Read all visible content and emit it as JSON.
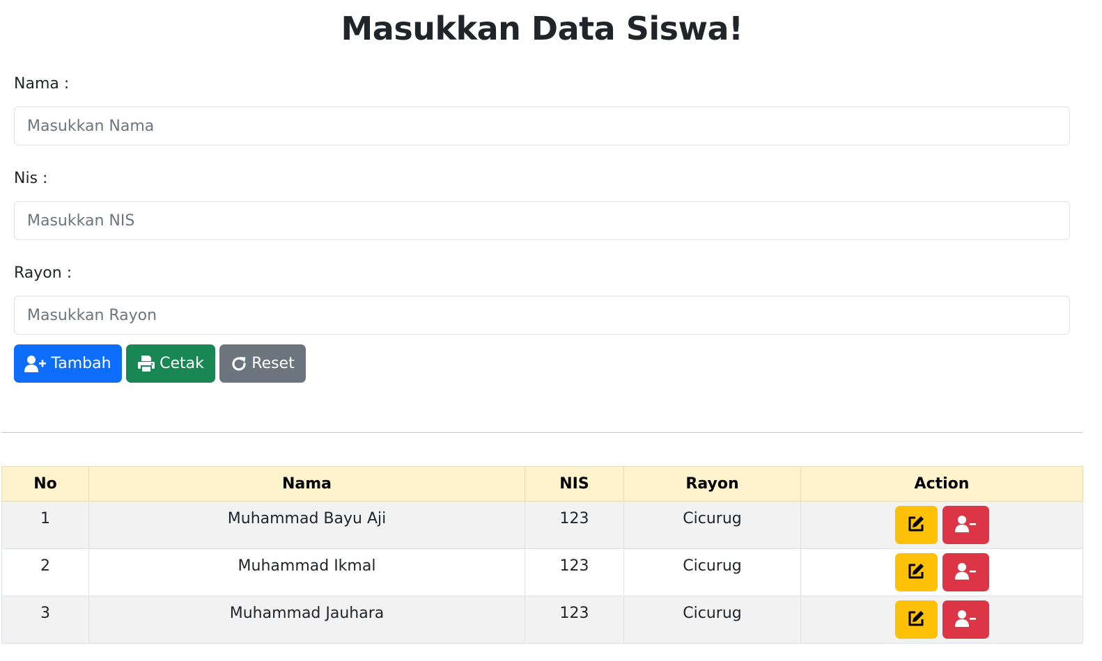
{
  "page": {
    "title": "Masukkan Data Siswa!"
  },
  "form": {
    "nama": {
      "label": "Nama :",
      "placeholder": "Masukkan Nama",
      "value": ""
    },
    "nis": {
      "label": "Nis :",
      "placeholder": "Masukkan NIS",
      "value": ""
    },
    "rayon": {
      "label": "Rayon :",
      "placeholder": "Masukkan Rayon",
      "value": ""
    }
  },
  "buttons": {
    "tambah": {
      "label": "Tambah",
      "icon": "user-plus-icon",
      "color": "#0d6efd"
    },
    "cetak": {
      "label": "Cetak",
      "icon": "printer-icon",
      "color": "#198754"
    },
    "reset": {
      "label": "Reset",
      "icon": "rotate-icon",
      "color": "#6c757d"
    }
  },
  "table": {
    "headers": [
      "No",
      "Nama",
      "NIS",
      "Rayon",
      "Action"
    ],
    "header_color": "#fff3cd",
    "rows": [
      {
        "no": "1",
        "nama": "Muhammad Bayu Aji",
        "nis": "123",
        "rayon": "Cicurug"
      },
      {
        "no": "2",
        "nama": "Muhammad Ikmal",
        "nis": "123",
        "rayon": "Cicurug"
      },
      {
        "no": "3",
        "nama": "Muhammad Jauhara",
        "nis": "123",
        "rayon": "Cicurug"
      }
    ],
    "actions": {
      "edit": {
        "icon": "edit-icon",
        "color": "#ffc107"
      },
      "delete": {
        "icon": "user-minus-icon",
        "color": "#dc3545"
      }
    }
  }
}
